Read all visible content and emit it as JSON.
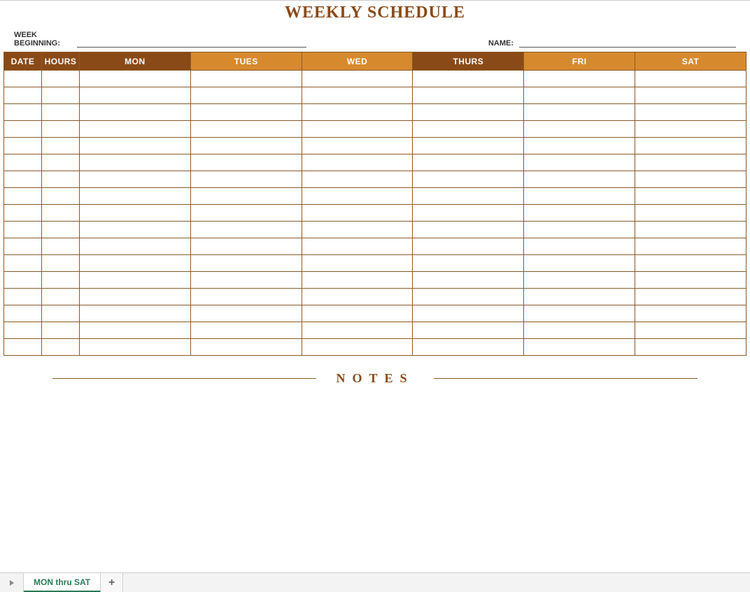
{
  "title": "WEEKLY SCHEDULE",
  "meta": {
    "week_beginning_label": "WEEK BEGINNING:",
    "week_beginning_value": "",
    "name_label": "NAME:",
    "name_value": ""
  },
  "schedule": {
    "headers": {
      "date": "DATE",
      "hours": "HOURS",
      "days": [
        "MON",
        "TUES",
        "WED",
        "THURS",
        "FRI",
        "SAT"
      ]
    },
    "row_count": 17
  },
  "notes_label": "NOTES",
  "tabs": {
    "active": "MON thru SAT"
  }
}
